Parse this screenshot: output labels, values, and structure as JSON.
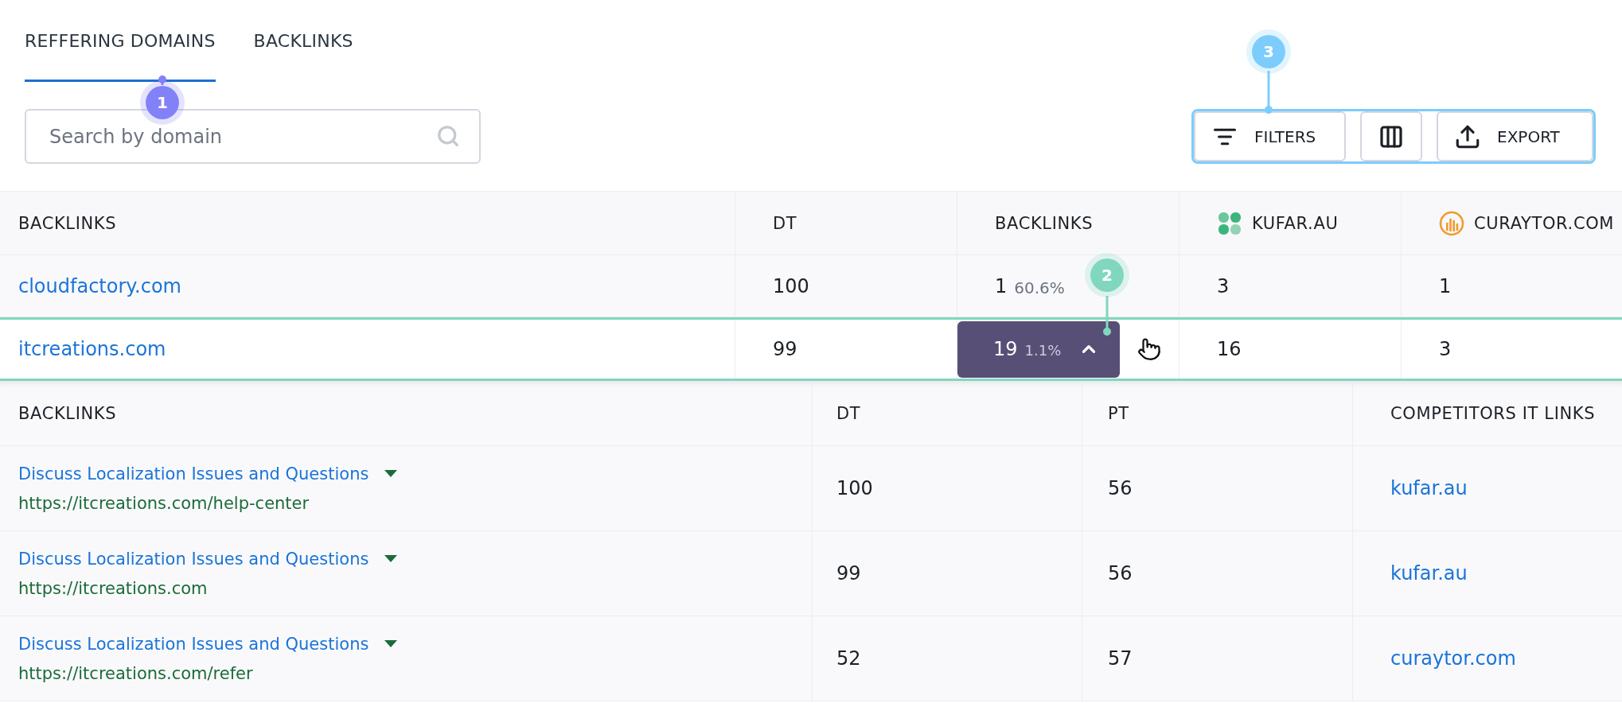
{
  "tabs": {
    "items": [
      {
        "label": "REFFERING DOMAINS",
        "selected": true
      },
      {
        "label": "BACKLINKS",
        "selected": false
      }
    ],
    "callout": {
      "label": "1",
      "color": "#8381f7"
    }
  },
  "search": {
    "placeholder": "Search by domain"
  },
  "toolbar": {
    "buttons": [
      {
        "kind": "filter",
        "label": "FILTERS"
      },
      {
        "kind": "columns"
      },
      {
        "kind": "export",
        "label": "EXPORT"
      }
    ],
    "callout": {
      "label": "3",
      "color": "#7ccdfc"
    }
  },
  "table": {
    "columns": [
      {
        "label": "BACKLINKS",
        "kind": "text"
      },
      {
        "label": "DT",
        "kind": "text"
      },
      {
        "label": "BACKLINKS",
        "kind": "text"
      },
      {
        "label": "KUFAR.AU",
        "kind": "site",
        "color": "#3cb57c"
      },
      {
        "label": "CURAYTOR.COM",
        "kind": "site",
        "color": "#f39a2e"
      }
    ],
    "rows": [
      {
        "domain": "cloudfactory.com",
        "dt": "100",
        "backlinks": "1",
        "share": "60.6%",
        "sites": [
          "3",
          "1"
        ],
        "expanded": false
      },
      {
        "domain": "itcreations.com",
        "dt": "99",
        "backlinks": "19",
        "share": "1.1%",
        "sites": [
          "16",
          "3"
        ],
        "expanded": true,
        "callout": {
          "label": "2",
          "color": "#80d7be"
        },
        "details": {
          "columns": [
            "BACKLINKS",
            "DT",
            "PT",
            "COMPETITORS IT LINKS"
          ],
          "rows": [
            {
              "title": "Discuss Localization Issues and Questions",
              "url": "https://itcreations.com/help-center",
              "dt": "100",
              "pt": "56",
              "competitor": "kufar.au"
            },
            {
              "title": "Discuss Localization Issues and Questions",
              "url": "https://itcreations.com",
              "dt": "99",
              "pt": "56",
              "competitor": "kufar.au"
            },
            {
              "title": "Discuss Localization Issues and Questions",
              "url": "https://itcreations.com/refer",
              "dt": "52",
              "pt": "57",
              "competitor": "curaytor.com"
            }
          ]
        }
      }
    ]
  }
}
